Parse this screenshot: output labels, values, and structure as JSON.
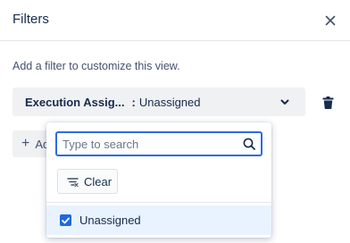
{
  "panel": {
    "title": "Filters",
    "description": "Add a filter to customize this view."
  },
  "filter": {
    "field": "Execution Assig...",
    "separator": ":",
    "value": "Unassigned"
  },
  "add_button": {
    "label": "Ad"
  },
  "dropdown": {
    "search_placeholder": "Type to search",
    "clear_label": "Clear",
    "options": [
      {
        "label": "Unassigned",
        "checked": true
      }
    ]
  },
  "colors": {
    "accent": "#2d6ae3",
    "checkbox": "#1d68e1",
    "selected_bg": "#e9f2ff",
    "chip_bg": "#f0f1f3"
  },
  "icons": {
    "close": "close-icon",
    "chevron": "chevron-down-icon",
    "delete": "trash-icon",
    "search": "search-icon",
    "clear": "clear-filter-icon",
    "check": "checkmark-icon"
  }
}
